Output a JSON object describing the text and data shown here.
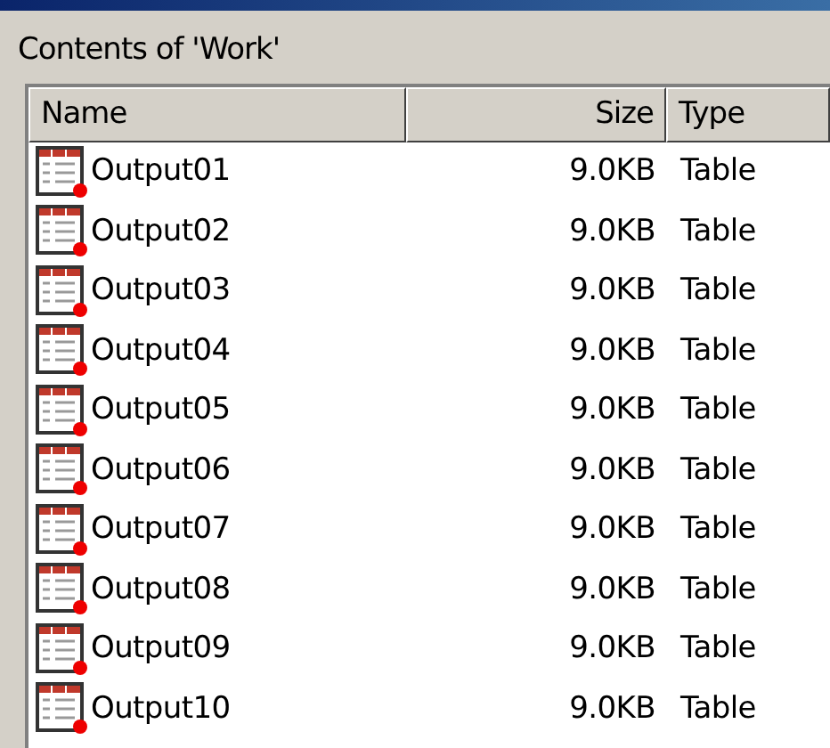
{
  "panel": {
    "title": "Contents of 'Work'"
  },
  "table": {
    "columns": [
      "Name",
      "Size",
      "Type"
    ],
    "rows": [
      {
        "name": "Output01",
        "size": "9.0KB",
        "type": "Table"
      },
      {
        "name": "Output02",
        "size": "9.0KB",
        "type": "Table"
      },
      {
        "name": "Output03",
        "size": "9.0KB",
        "type": "Table"
      },
      {
        "name": "Output04",
        "size": "9.0KB",
        "type": "Table"
      },
      {
        "name": "Output05",
        "size": "9.0KB",
        "type": "Table"
      },
      {
        "name": "Output06",
        "size": "9.0KB",
        "type": "Table"
      },
      {
        "name": "Output07",
        "size": "9.0KB",
        "type": "Table"
      },
      {
        "name": "Output08",
        "size": "9.0KB",
        "type": "Table"
      },
      {
        "name": "Output09",
        "size": "9.0KB",
        "type": "Table"
      },
      {
        "name": "Output10",
        "size": "9.0KB",
        "type": "Table"
      }
    ]
  }
}
